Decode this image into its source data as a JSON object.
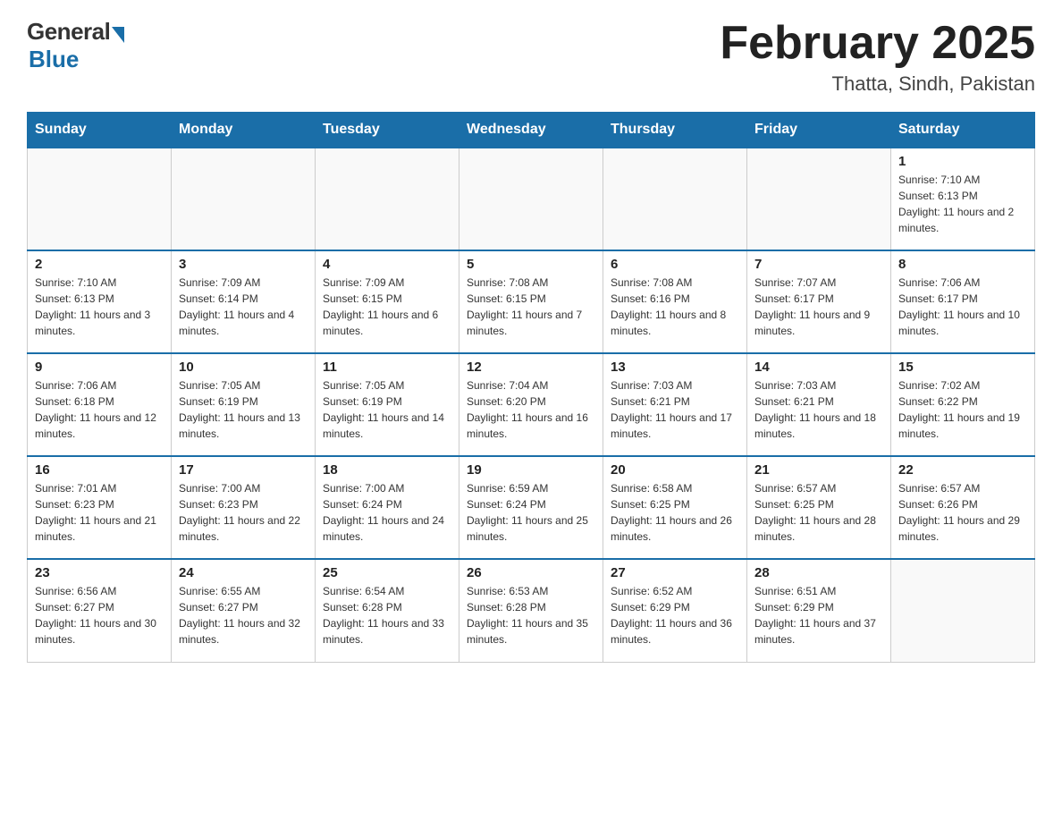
{
  "header": {
    "logo_general": "General",
    "logo_blue": "Blue",
    "title": "February 2025",
    "subtitle": "Thatta, Sindh, Pakistan"
  },
  "days_of_week": [
    "Sunday",
    "Monday",
    "Tuesday",
    "Wednesday",
    "Thursday",
    "Friday",
    "Saturday"
  ],
  "weeks": [
    [
      {
        "day": "",
        "sunrise": "",
        "sunset": "",
        "daylight": "",
        "empty": true
      },
      {
        "day": "",
        "sunrise": "",
        "sunset": "",
        "daylight": "",
        "empty": true
      },
      {
        "day": "",
        "sunrise": "",
        "sunset": "",
        "daylight": "",
        "empty": true
      },
      {
        "day": "",
        "sunrise": "",
        "sunset": "",
        "daylight": "",
        "empty": true
      },
      {
        "day": "",
        "sunrise": "",
        "sunset": "",
        "daylight": "",
        "empty": true
      },
      {
        "day": "",
        "sunrise": "",
        "sunset": "",
        "daylight": "",
        "empty": true
      },
      {
        "day": "1",
        "sunrise": "Sunrise: 7:10 AM",
        "sunset": "Sunset: 6:13 PM",
        "daylight": "Daylight: 11 hours and 2 minutes.",
        "empty": false
      }
    ],
    [
      {
        "day": "2",
        "sunrise": "Sunrise: 7:10 AM",
        "sunset": "Sunset: 6:13 PM",
        "daylight": "Daylight: 11 hours and 3 minutes.",
        "empty": false
      },
      {
        "day": "3",
        "sunrise": "Sunrise: 7:09 AM",
        "sunset": "Sunset: 6:14 PM",
        "daylight": "Daylight: 11 hours and 4 minutes.",
        "empty": false
      },
      {
        "day": "4",
        "sunrise": "Sunrise: 7:09 AM",
        "sunset": "Sunset: 6:15 PM",
        "daylight": "Daylight: 11 hours and 6 minutes.",
        "empty": false
      },
      {
        "day": "5",
        "sunrise": "Sunrise: 7:08 AM",
        "sunset": "Sunset: 6:15 PM",
        "daylight": "Daylight: 11 hours and 7 minutes.",
        "empty": false
      },
      {
        "day": "6",
        "sunrise": "Sunrise: 7:08 AM",
        "sunset": "Sunset: 6:16 PM",
        "daylight": "Daylight: 11 hours and 8 minutes.",
        "empty": false
      },
      {
        "day": "7",
        "sunrise": "Sunrise: 7:07 AM",
        "sunset": "Sunset: 6:17 PM",
        "daylight": "Daylight: 11 hours and 9 minutes.",
        "empty": false
      },
      {
        "day": "8",
        "sunrise": "Sunrise: 7:06 AM",
        "sunset": "Sunset: 6:17 PM",
        "daylight": "Daylight: 11 hours and 10 minutes.",
        "empty": false
      }
    ],
    [
      {
        "day": "9",
        "sunrise": "Sunrise: 7:06 AM",
        "sunset": "Sunset: 6:18 PM",
        "daylight": "Daylight: 11 hours and 12 minutes.",
        "empty": false
      },
      {
        "day": "10",
        "sunrise": "Sunrise: 7:05 AM",
        "sunset": "Sunset: 6:19 PM",
        "daylight": "Daylight: 11 hours and 13 minutes.",
        "empty": false
      },
      {
        "day": "11",
        "sunrise": "Sunrise: 7:05 AM",
        "sunset": "Sunset: 6:19 PM",
        "daylight": "Daylight: 11 hours and 14 minutes.",
        "empty": false
      },
      {
        "day": "12",
        "sunrise": "Sunrise: 7:04 AM",
        "sunset": "Sunset: 6:20 PM",
        "daylight": "Daylight: 11 hours and 16 minutes.",
        "empty": false
      },
      {
        "day": "13",
        "sunrise": "Sunrise: 7:03 AM",
        "sunset": "Sunset: 6:21 PM",
        "daylight": "Daylight: 11 hours and 17 minutes.",
        "empty": false
      },
      {
        "day": "14",
        "sunrise": "Sunrise: 7:03 AM",
        "sunset": "Sunset: 6:21 PM",
        "daylight": "Daylight: 11 hours and 18 minutes.",
        "empty": false
      },
      {
        "day": "15",
        "sunrise": "Sunrise: 7:02 AM",
        "sunset": "Sunset: 6:22 PM",
        "daylight": "Daylight: 11 hours and 19 minutes.",
        "empty": false
      }
    ],
    [
      {
        "day": "16",
        "sunrise": "Sunrise: 7:01 AM",
        "sunset": "Sunset: 6:23 PM",
        "daylight": "Daylight: 11 hours and 21 minutes.",
        "empty": false
      },
      {
        "day": "17",
        "sunrise": "Sunrise: 7:00 AM",
        "sunset": "Sunset: 6:23 PM",
        "daylight": "Daylight: 11 hours and 22 minutes.",
        "empty": false
      },
      {
        "day": "18",
        "sunrise": "Sunrise: 7:00 AM",
        "sunset": "Sunset: 6:24 PM",
        "daylight": "Daylight: 11 hours and 24 minutes.",
        "empty": false
      },
      {
        "day": "19",
        "sunrise": "Sunrise: 6:59 AM",
        "sunset": "Sunset: 6:24 PM",
        "daylight": "Daylight: 11 hours and 25 minutes.",
        "empty": false
      },
      {
        "day": "20",
        "sunrise": "Sunrise: 6:58 AM",
        "sunset": "Sunset: 6:25 PM",
        "daylight": "Daylight: 11 hours and 26 minutes.",
        "empty": false
      },
      {
        "day": "21",
        "sunrise": "Sunrise: 6:57 AM",
        "sunset": "Sunset: 6:25 PM",
        "daylight": "Daylight: 11 hours and 28 minutes.",
        "empty": false
      },
      {
        "day": "22",
        "sunrise": "Sunrise: 6:57 AM",
        "sunset": "Sunset: 6:26 PM",
        "daylight": "Daylight: 11 hours and 29 minutes.",
        "empty": false
      }
    ],
    [
      {
        "day": "23",
        "sunrise": "Sunrise: 6:56 AM",
        "sunset": "Sunset: 6:27 PM",
        "daylight": "Daylight: 11 hours and 30 minutes.",
        "empty": false
      },
      {
        "day": "24",
        "sunrise": "Sunrise: 6:55 AM",
        "sunset": "Sunset: 6:27 PM",
        "daylight": "Daylight: 11 hours and 32 minutes.",
        "empty": false
      },
      {
        "day": "25",
        "sunrise": "Sunrise: 6:54 AM",
        "sunset": "Sunset: 6:28 PM",
        "daylight": "Daylight: 11 hours and 33 minutes.",
        "empty": false
      },
      {
        "day": "26",
        "sunrise": "Sunrise: 6:53 AM",
        "sunset": "Sunset: 6:28 PM",
        "daylight": "Daylight: 11 hours and 35 minutes.",
        "empty": false
      },
      {
        "day": "27",
        "sunrise": "Sunrise: 6:52 AM",
        "sunset": "Sunset: 6:29 PM",
        "daylight": "Daylight: 11 hours and 36 minutes.",
        "empty": false
      },
      {
        "day": "28",
        "sunrise": "Sunrise: 6:51 AM",
        "sunset": "Sunset: 6:29 PM",
        "daylight": "Daylight: 11 hours and 37 minutes.",
        "empty": false
      },
      {
        "day": "",
        "sunrise": "",
        "sunset": "",
        "daylight": "",
        "empty": true
      }
    ]
  ]
}
